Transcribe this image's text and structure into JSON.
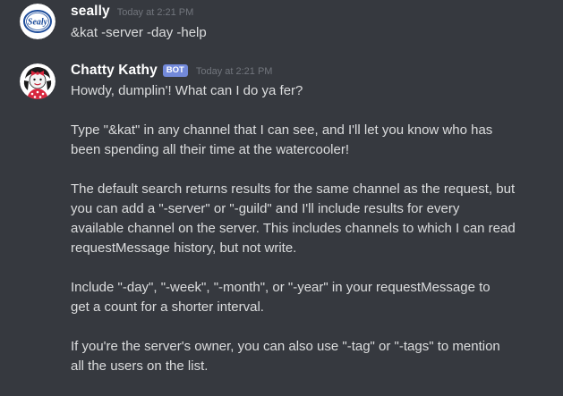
{
  "messages": [
    {
      "username": "seally",
      "timestamp": "Today at 2:21 PM",
      "avatar": "sealy-logo-avatar",
      "text": "&kat -server -day -help"
    },
    {
      "username": "Chatty Kathy",
      "badge": "BOT",
      "timestamp": "Today at 2:21 PM",
      "avatar": "chatty-kathy-avatar",
      "paragraphs": [
        "Howdy, dumplin'! What can I do ya fer?",
        "Type \"&kat\" in any channel that I can see, and I'll let you know who has\nbeen spending all their time at the watercooler!",
        "The default search returns results for the same channel as the request, but\nyou can add a \"-server\" or \"-guild\" and I'll include results for every\navailable channel on the server. This includes channels to which I can read\nrequestMessage history, but not write.",
        "Include \"-day\", \"-week\", \"-month\", or \"-year\" in your requestMessage to\nget a count for a shorter interval.",
        "If you're the server's owner, you can also use \"-tag\" or \"-tags\" to mention\nall the users on the list."
      ]
    }
  ],
  "colors": {
    "background": "#36393f",
    "text": "#dcddde",
    "username": "#ffffff",
    "timestamp": "#72767d",
    "bot_badge": "#7289da"
  }
}
